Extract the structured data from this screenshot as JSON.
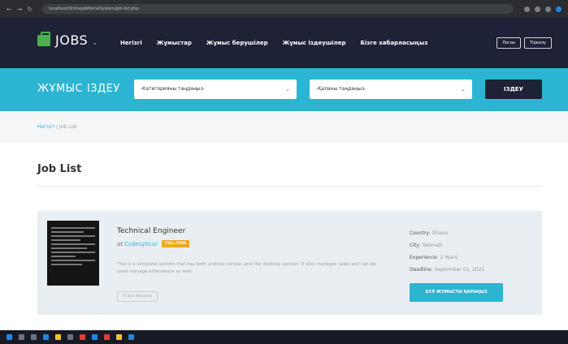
{
  "browser": {
    "url": "localhost/OnlineJobPortalSystem/job-list.php"
  },
  "nav": {
    "logo": "JOBS",
    "logo_dot": ".",
    "menu": [
      "Негізгі",
      "Жұмыстар",
      "Жұмыс берушілер",
      "Жұмыс іздеушілер",
      "Бізге хабарласыңыз"
    ],
    "auth": [
      "Логин",
      "Тіркелу"
    ]
  },
  "search": {
    "title": "ЖҰМЫС ІЗДЕУ",
    "category_placeholder": "-Категорияны таңдаңыз-",
    "city_placeholder": "-Қаланы таңдаңыз-",
    "button": "ІЗДЕУ"
  },
  "breadcrumb": {
    "home": "Негізгі",
    "sep": "/",
    "current": "Job List"
  },
  "page": {
    "title": "Job List"
  },
  "job": {
    "title": "Technical Engineer",
    "at": "at",
    "company": "CodeLytical",
    "type": "FULL-TIME",
    "description": "This is a complete system that has both android version and the desktop version. It also manages sales and can be used manage attendance as well.",
    "tag": "IT and Telecoms",
    "country_label": "Country:",
    "country": "Ghana",
    "city_label": "City:",
    "city": "Takoradi",
    "experience_label": "Experience:",
    "experience": "2 Years",
    "deadline_label": "Deadline:",
    "deadline": "September 01, 2021",
    "details_button": "БҰЛ ЖҰМЫСТЫ ҚАРАҢЫЗ"
  },
  "colors": {
    "nav_bg": "#1d2236",
    "accent": "#2bb5d3",
    "badge": "#f5a623"
  }
}
